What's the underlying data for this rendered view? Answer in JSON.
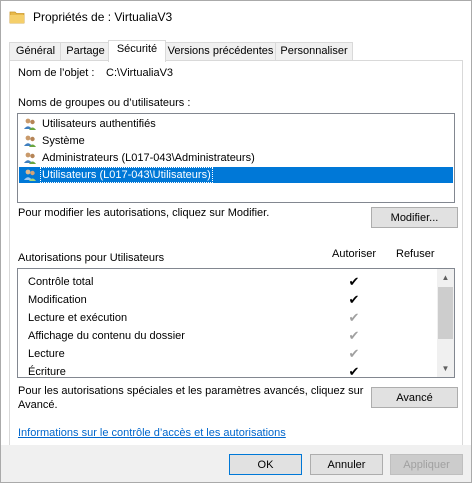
{
  "window": {
    "title": "Propriétés de : VirtualiaV3"
  },
  "tabs": [
    {
      "label": "Général"
    },
    {
      "label": "Partage"
    },
    {
      "label": "Sécurité"
    },
    {
      "label": "Versions précédentes"
    },
    {
      "label": "Personnaliser"
    }
  ],
  "security": {
    "object_name_label": "Nom de l’objet :",
    "object_name_value": "C:\\VirtualiaV3",
    "groups_label": "Noms de groupes ou d’utilisateurs :",
    "groups": [
      {
        "label": "Utilisateurs authentifiés",
        "selected": false
      },
      {
        "label": "Système",
        "selected": false
      },
      {
        "label": "Administrateurs (L017-043\\Administrateurs)",
        "selected": false
      },
      {
        "label": "Utilisateurs (L017-043\\Utilisateurs)",
        "selected": true
      }
    ],
    "modify_hint": "Pour modifier les autorisations, cliquez sur Modifier.",
    "modify_button": "Modifier...",
    "permissions_label": "Autorisations pour Utilisateurs",
    "allow_header": "Autoriser",
    "deny_header": "Refuser",
    "permissions": [
      {
        "name": "Contrôle total",
        "allow": "explicit"
      },
      {
        "name": "Modification",
        "allow": "explicit"
      },
      {
        "name": "Lecture et exécution",
        "allow": "inherited"
      },
      {
        "name": "Affichage du contenu du dossier",
        "allow": "inherited"
      },
      {
        "name": "Lecture",
        "allow": "inherited"
      },
      {
        "name": "Écriture",
        "allow": "explicit"
      }
    ],
    "advanced_hint_line1": "Pour les autorisations spéciales et les paramètres avancés, cliquez sur",
    "advanced_hint_line2": "Avancé.",
    "advanced_button": "Avancé",
    "info_link": "Informations sur le contrôle d’accès et les autorisations"
  },
  "footer": {
    "ok": "OK",
    "cancel": "Annuler",
    "apply": "Appliquer"
  },
  "colors": {
    "selection": "#0078d7",
    "link": "#0066cc",
    "check_explicit": "#000000",
    "check_inherited": "#a0a0a0"
  },
  "icons": {
    "title": "folder-icon",
    "group": "users-group-icon",
    "check": "checkmark-icon"
  }
}
